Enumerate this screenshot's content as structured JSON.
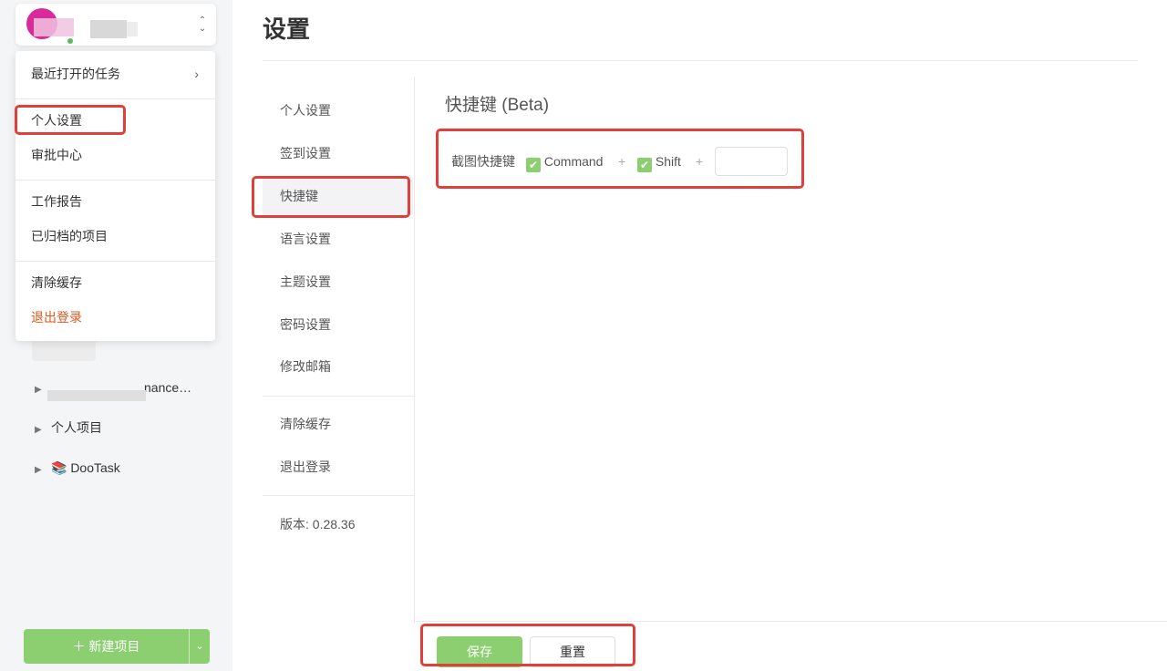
{
  "sidebar": {
    "dropdown": {
      "items": [
        {
          "label": "最近打开的任务"
        },
        {
          "label": "个人设置"
        },
        {
          "label": "审批中心"
        },
        {
          "label": "工作报告"
        },
        {
          "label": "已归档的项目"
        },
        {
          "label": "清除缓存"
        },
        {
          "label": "退出登录"
        }
      ]
    },
    "projects": [
      {
        "label": "nance…"
      },
      {
        "label": "个人项目"
      },
      {
        "label": "📚 DooTask"
      }
    ],
    "new_project_label": "＋  新建项目"
  },
  "main": {
    "title": "设置",
    "menu": [
      {
        "label": "个人设置"
      },
      {
        "label": "签到设置"
      },
      {
        "label": "快捷键"
      },
      {
        "label": "语言设置"
      },
      {
        "label": "主题设置"
      },
      {
        "label": "密码设置"
      },
      {
        "label": "修改邮箱"
      },
      {
        "label": "清除缓存"
      },
      {
        "label": "退出登录"
      }
    ],
    "version": "版本: 0.28.36",
    "section_title": "快捷键 (Beta)",
    "shortcut": {
      "label": "截图快捷键",
      "key1": "Command",
      "key2": "Shift",
      "plus": "+",
      "key3_value": ""
    },
    "save_label": "保存",
    "reset_label": "重置"
  },
  "colors": {
    "accent": "#8bcf70",
    "danger_text": "#e2561e",
    "annotation": "#e0403a",
    "sidebar_bg": "#f4f5f7"
  }
}
